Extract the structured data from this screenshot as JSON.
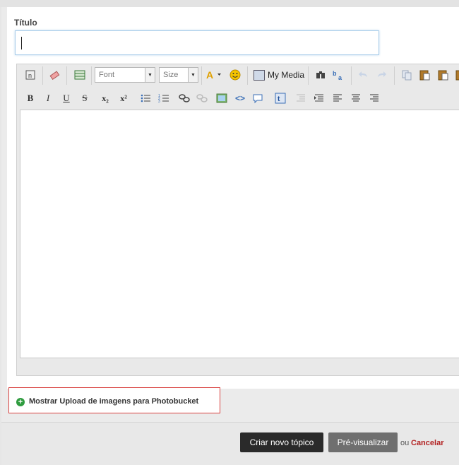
{
  "form": {
    "title_label": "Título",
    "title_value": ""
  },
  "toolbar_row1": {
    "font_label": "Font",
    "size_label": "Size",
    "my_media_label": "My Media",
    "icons": [
      "source-icon",
      "eraser-icon",
      "table-icon",
      "font-combo",
      "size-combo",
      "text-color-icon",
      "smiley-icon",
      "my-media-icon",
      "find-icon",
      "replace-icon",
      "undo-icon",
      "redo-icon",
      "copy-icon",
      "paste-icon",
      "paste-text-icon"
    ]
  },
  "toolbar_row2": {
    "bold": "B",
    "italic": "I",
    "underline": "U",
    "strike": "S",
    "subscript": "x₂",
    "superscript": "x²",
    "code": "<>"
  },
  "upload": {
    "label": "Mostrar Upload de imagens para Photobucket"
  },
  "footer": {
    "create_label": "Criar novo tópico",
    "preview_label": "Pré-visualizar",
    "or_label": "ou",
    "cancel_label": "Cancelar"
  },
  "colors": {
    "highlight_border": "#d9413f",
    "cancel": "#b32424",
    "plus_green": "#2f9c3f"
  }
}
